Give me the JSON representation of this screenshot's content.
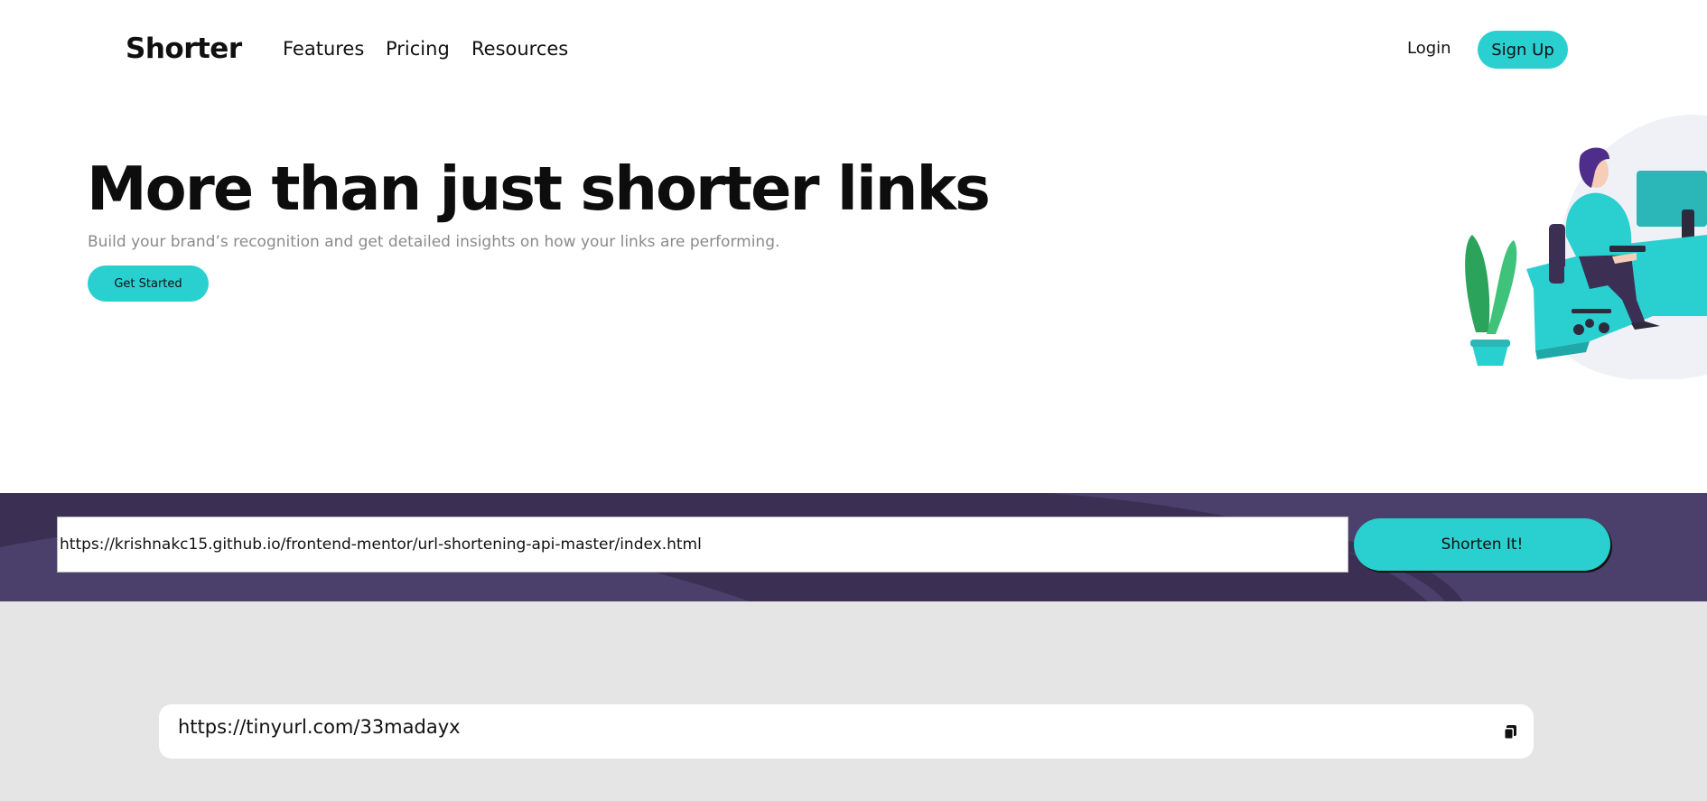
{
  "nav": {
    "logo": "Shorter",
    "links": [
      "Features",
      "Pricing",
      "Resources"
    ],
    "login": "Login",
    "signup": "Sign Up"
  },
  "hero": {
    "title": "More than just shorter links",
    "subtitle": "Build your brand’s recognition and get detailed insights on how your links are performing.",
    "cta": "Get Started",
    "illustration_icon": "person-working-at-desk-illustration"
  },
  "shorten": {
    "input_value": "https://krishnakc15.github.io/frontend-mentor/url-shortening-api-master/index.html",
    "button": "Shorten It!"
  },
  "results": [
    {
      "short_url": "https://tinyurl.com/33madayx",
      "icon": "copy-icon"
    }
  ],
  "colors": {
    "accent": "#2acfcf",
    "band": "#3b3054",
    "results_bg": "#e5e5e5"
  }
}
